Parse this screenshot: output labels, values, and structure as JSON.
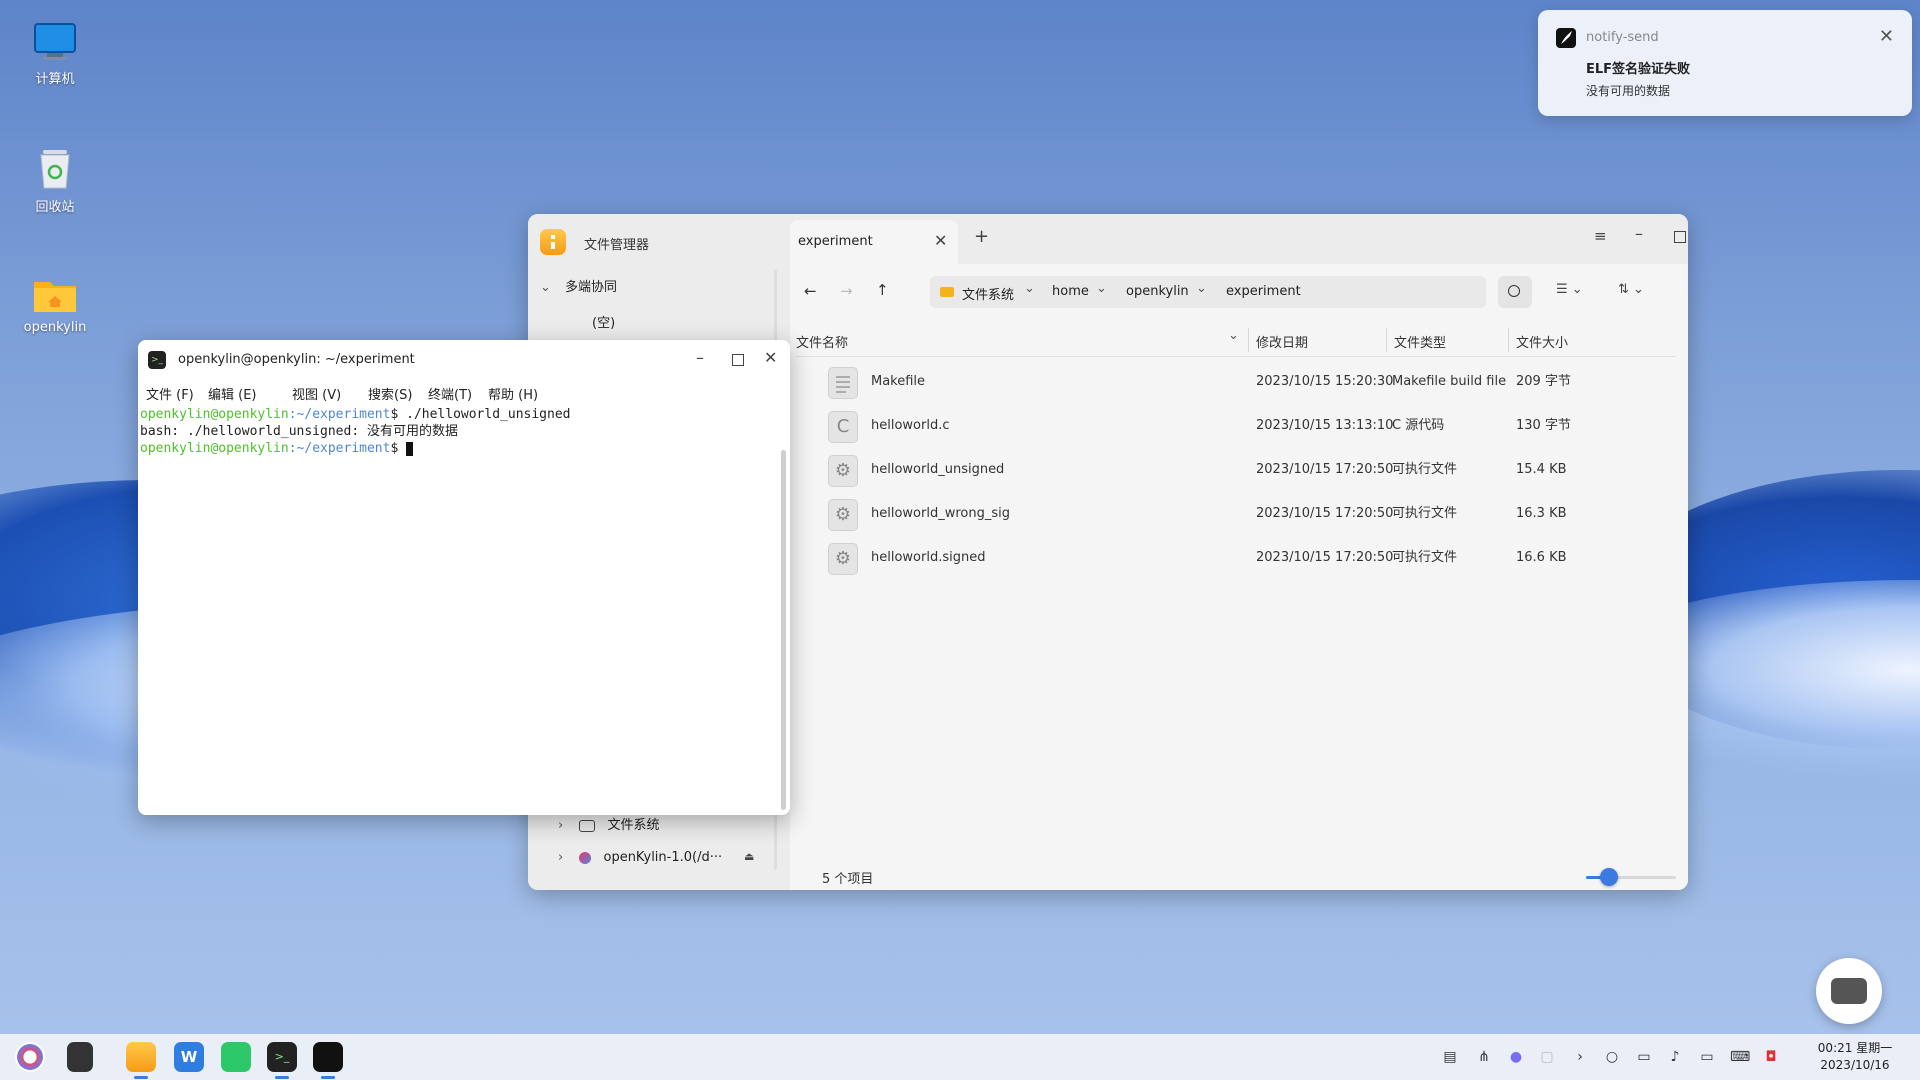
{
  "desktop": {
    "icons": [
      {
        "label": "计算机",
        "icon": "computer-icon"
      },
      {
        "label": "回收站",
        "icon": "trash-icon"
      },
      {
        "label": "openkylin",
        "icon": "home-folder-icon"
      }
    ]
  },
  "notification": {
    "app": "notify-send",
    "title": "ELF签名验证失败",
    "body": "没有可用的数据"
  },
  "file_manager": {
    "app_title": "文件管理器",
    "sidebar": {
      "section": "多端协同",
      "empty": "(空)",
      "items": [
        {
          "label": "文件系统",
          "icon": "drive-icon"
        },
        {
          "label": "openKylin-1.0(/d···",
          "icon": "disc-icon"
        }
      ]
    },
    "tab": {
      "label": "experiment"
    },
    "path": {
      "segments": [
        "文件系统",
        "home",
        "openkylin",
        "experiment"
      ]
    },
    "columns": [
      "文件名称",
      "修改日期",
      "文件类型",
      "文件大小"
    ],
    "files": [
      {
        "name": "Makefile",
        "date": "2023/10/15 15:20:30",
        "type": "Makefile build file",
        "size": "209 字节",
        "icon": "text-file-icon"
      },
      {
        "name": "helloworld.c",
        "date": "2023/10/15 13:13:10",
        "type": "C 源代码",
        "size": "130 字节",
        "icon": "c-source-icon"
      },
      {
        "name": "helloworld_unsigned",
        "date": "2023/10/15 17:20:50",
        "type": "可执行文件",
        "size": "15.4 KB",
        "icon": "executable-icon"
      },
      {
        "name": "helloworld_wrong_sig",
        "date": "2023/10/15 17:20:50",
        "type": "可执行文件",
        "size": "16.3 KB",
        "icon": "executable-icon"
      },
      {
        "name": "helloworld.signed",
        "date": "2023/10/15 17:20:50",
        "type": "可执行文件",
        "size": "16.6 KB",
        "icon": "executable-icon"
      }
    ],
    "status": "5 个项目",
    "zoom_level": 0.25
  },
  "terminal": {
    "title": "openkylin@openkylin: ~/experiment",
    "menu": [
      "文件 (F)",
      "编辑 (E)",
      "视图 (V)",
      "搜索(S)",
      "终端(T)",
      "帮助 (H)"
    ],
    "lines": [
      {
        "user": "openkylin@openkylin",
        "path": ":~/experiment",
        "rest": "$ ./helloworld_unsigned"
      },
      {
        "plain": "bash: ./helloworld_unsigned: 没有可用的数据"
      },
      {
        "user": "openkylin@openkylin",
        "path": ":~/experiment",
        "rest": "$ "
      }
    ],
    "colors": {
      "user": "#4ec22a",
      "path": "#4f86d9"
    }
  },
  "taskbar": {
    "clock_time": "00:21 星期一",
    "clock_date": "2023/10/16",
    "apps": [
      "start-menu-icon",
      "multitask-view-icon",
      "file-manager-icon",
      "wps-writer-icon",
      "chat-app-icon",
      "terminal-icon",
      "kylin-pen-icon"
    ]
  }
}
